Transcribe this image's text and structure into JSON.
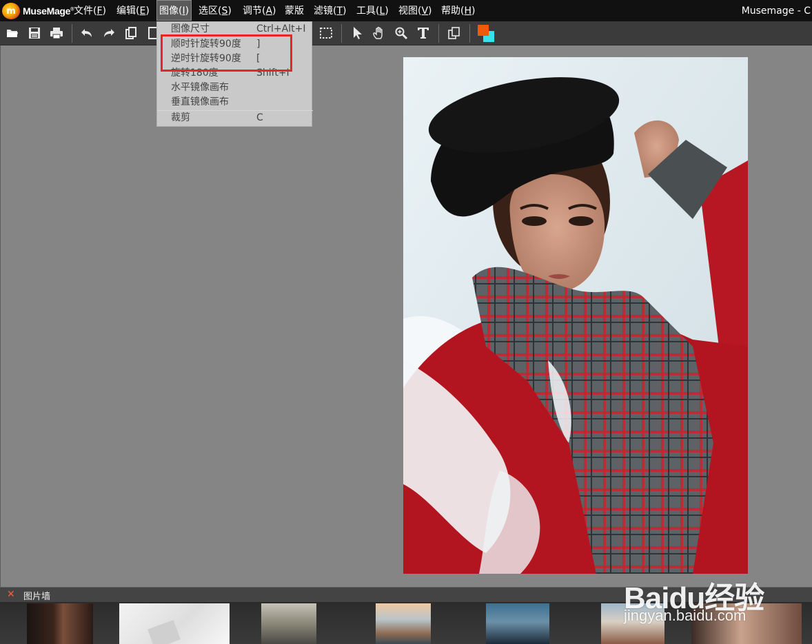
{
  "app": {
    "brand": "MuseMage",
    "window_title": "Musemage - C"
  },
  "menubar": {
    "items": [
      {
        "label": "文件(F)",
        "underline": "F"
      },
      {
        "label": "编辑(E)",
        "underline": "E"
      },
      {
        "label": "图像(I)",
        "underline": "I"
      },
      {
        "label": "选区(S)",
        "underline": "S"
      },
      {
        "label": "调节(A)",
        "underline": "A"
      },
      {
        "label": "蒙版",
        "underline": ""
      },
      {
        "label": "滤镜(T)",
        "underline": "T"
      },
      {
        "label": "工具(L)",
        "underline": "L"
      },
      {
        "label": "视图(V)",
        "underline": "V"
      },
      {
        "label": "帮助(H)",
        "underline": "H"
      }
    ]
  },
  "toolbar": {
    "icons": [
      "open-folder-icon",
      "save-icon",
      "print-icon",
      "undo-icon",
      "redo-icon",
      "copy-icon",
      "new-page-icon",
      "marquee-select-icon",
      "pointer-icon",
      "hand-icon",
      "zoom-icon",
      "text-icon",
      "layers-icon",
      "color-swatch-icon"
    ],
    "foreground_color": "#f05a0a",
    "background_color": "#37e3e8"
  },
  "image_menu": {
    "items": [
      {
        "label": "图像尺寸",
        "shortcut": "Ctrl+Alt+I"
      },
      {
        "label": "顺时针旋转90度",
        "shortcut": "]"
      },
      {
        "label": "逆时针旋转90度",
        "shortcut": "["
      },
      {
        "label": "旋转180度",
        "shortcut": "Shift+I"
      },
      {
        "label": "水平镜像画布",
        "shortcut": ""
      },
      {
        "label": "垂直镜像画布",
        "shortcut": ""
      },
      {
        "label": "裁剪",
        "shortcut": "C"
      }
    ],
    "highlight_color": "#e8232b"
  },
  "photo_wall": {
    "title": "图片墙",
    "close_glyph": "✕"
  },
  "watermark": {
    "big": "Baidu经验",
    "small": "jingyan.baidu.com"
  }
}
